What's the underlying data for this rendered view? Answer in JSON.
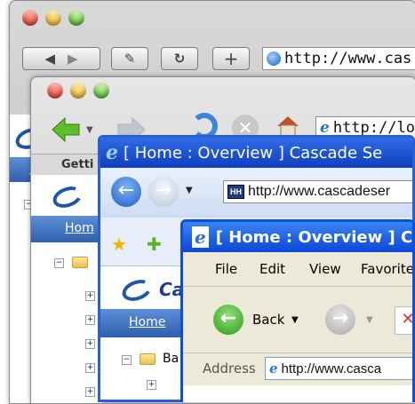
{
  "safari": {
    "address": "http://www.cas"
  },
  "firefox": {
    "address": "http://lo",
    "tab_label": "Getti"
  },
  "ie7": {
    "title": "[ Home : Overview ] Cascade Se",
    "address": "http://www.cascadeser",
    "nav_home": "Hom",
    "address_badge": "HH"
  },
  "ie6": {
    "title": "[ Home : Overview ] Ca",
    "menu": [
      "File",
      "Edit",
      "View",
      "Favorite"
    ],
    "back_label": "Back",
    "address_label": "Address",
    "address": "http://www.casca"
  },
  "page": {
    "nav_home_partial": "Home",
    "logo_text": "Ca",
    "tree_item": "Ba",
    "safari_nav_home": "H"
  },
  "colors": {
    "ie7_blue": "#2a5fd0",
    "ie6_blue": "#0a4fe0",
    "nav_blue": "#3c6dbd"
  }
}
